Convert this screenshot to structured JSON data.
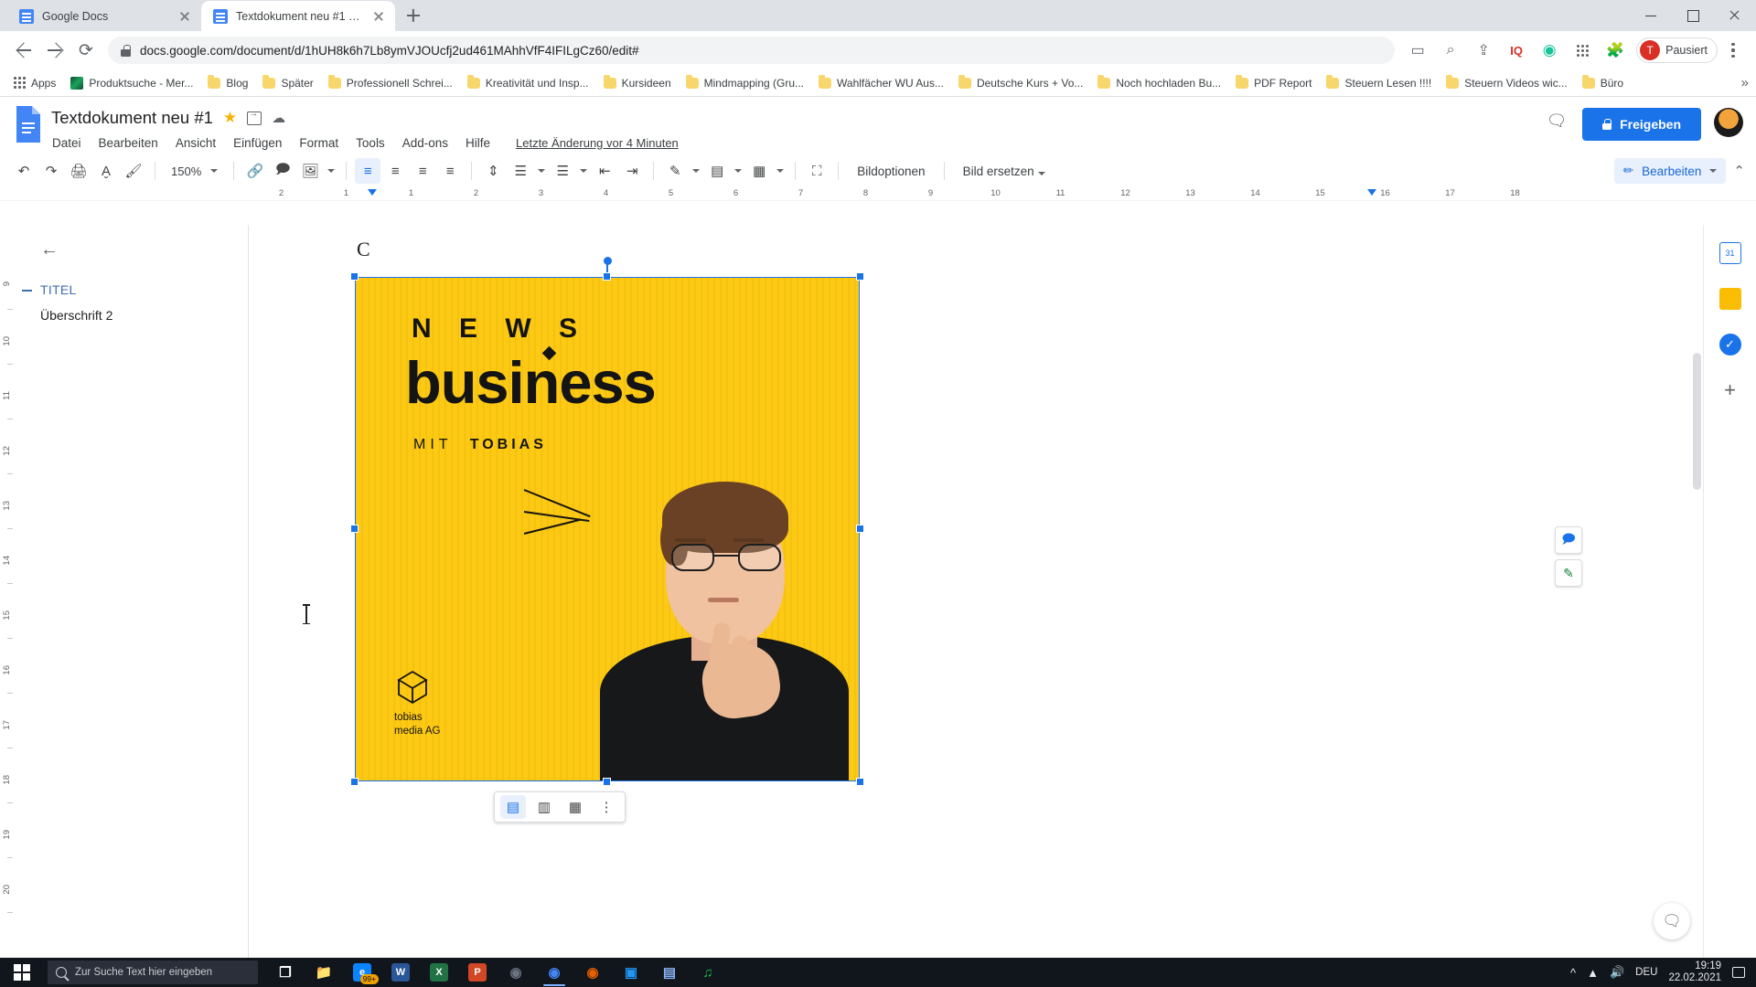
{
  "browser": {
    "tabs": [
      {
        "title": "Google Docs",
        "active": false
      },
      {
        "title": "Textdokument neu #1 - Google D",
        "active": true
      }
    ],
    "new_tab_label": "+",
    "url": "docs.google.com/document/d/1hUH8k6h7Lb8ymVJOUcfj2ud461MAhhVfF4IFILgCz60/edit#",
    "window_controls": {
      "minimize": "–",
      "maximize": "□",
      "close": "×"
    },
    "omnibox_icons": [
      "cast-icon",
      "zoom-icon",
      "share-icon",
      "iq-icon",
      "grammar-icon",
      "apps-icon",
      "extensions-icon"
    ],
    "profile": {
      "initial": "T",
      "label": "Pausiert"
    },
    "bookmarks": [
      {
        "label": "Apps",
        "icon": "apps-grid-icon"
      },
      {
        "label": "Produktsuche - Mer...",
        "icon": "site-favicon"
      },
      {
        "label": "Blog",
        "icon": "folder-icon"
      },
      {
        "label": "Später",
        "icon": "folder-icon"
      },
      {
        "label": "Professionell Schrei...",
        "icon": "folder-icon"
      },
      {
        "label": "Kreativität und Insp...",
        "icon": "folder-icon"
      },
      {
        "label": "Kursideen",
        "icon": "folder-icon"
      },
      {
        "label": "Mindmapping  (Gru...",
        "icon": "folder-icon"
      },
      {
        "label": "Wahlfächer WU Aus...",
        "icon": "folder-icon"
      },
      {
        "label": "Deutsche Kurs + Vo...",
        "icon": "folder-icon"
      },
      {
        "label": "Noch hochladen Bu...",
        "icon": "folder-icon"
      },
      {
        "label": "PDF Report",
        "icon": "folder-icon"
      },
      {
        "label": "Steuern Lesen !!!!",
        "icon": "folder-icon"
      },
      {
        "label": "Steuern Videos wic...",
        "icon": "folder-icon"
      },
      {
        "label": "Büro",
        "icon": "folder-icon"
      }
    ],
    "bookmarks_overflow": "»"
  },
  "docs": {
    "title": "Textdokument neu #1",
    "star_icon": "★",
    "menus": [
      "Datei",
      "Bearbeiten",
      "Ansicht",
      "Einfügen",
      "Format",
      "Tools",
      "Add-ons",
      "Hilfe"
    ],
    "last_edit": "Letzte Änderung vor 4 Minuten",
    "share_label": "Freigeben",
    "comment_icon": "comment-icon",
    "toolbar": {
      "zoom": "150%",
      "image_options": "Bildoptionen",
      "replace_image": "Bild ersetzen",
      "mode": "Bearbeiten"
    },
    "ruler": {
      "ticks": [
        "2",
        "1",
        "1",
        "2",
        "3",
        "4",
        "5",
        "6",
        "7",
        "8",
        "9",
        "10",
        "11",
        "12",
        "13",
        "14",
        "15",
        "16",
        "17",
        "18"
      ]
    },
    "vertical_ruler_ticks": [
      "9",
      "10",
      "11",
      "12",
      "13",
      "14",
      "15",
      "16",
      "17",
      "18",
      "19",
      "20"
    ],
    "outline": {
      "back_icon": "←",
      "items": [
        {
          "label": "TITEL",
          "level": "title"
        },
        {
          "label": "Überschrift 2",
          "level": "h2"
        }
      ]
    },
    "document": {
      "text_line": "C",
      "image": {
        "alt": "News business podcast cover",
        "bg_color": "#fdc913",
        "headline_small": "N E W S",
        "headline_large": "business",
        "subtitle_prefix": "MIT",
        "subtitle_name": "TOBIAS",
        "logo_line1": "tobias",
        "logo_line2": "media AG"
      }
    },
    "image_toolbar": {
      "buttons": [
        "wrap-inline-icon",
        "wrap-text-icon",
        "break-text-icon",
        "more-options-icon"
      ]
    },
    "side_actions": [
      "add-comment-icon",
      "suggest-edit-icon"
    ],
    "right_rail": [
      "google-keep-icon",
      "google-tasks-icon",
      "google-calendar-icon",
      "add-ons-plus-icon"
    ],
    "explore_icon": "explore-icon"
  },
  "taskbar": {
    "search_placeholder": "Zur Suche Text hier eingeben",
    "apps": [
      {
        "name": "task-view-icon",
        "glyph": "❐",
        "color": "#ffffff"
      },
      {
        "name": "file-explorer-icon",
        "glyph": "📁",
        "color": "#f6b93b"
      },
      {
        "name": "edge-icon",
        "glyph": "e",
        "color": "#0a84ff",
        "badge": "99+"
      },
      {
        "name": "word-icon",
        "glyph": "W",
        "color": "#2b579a"
      },
      {
        "name": "excel-icon",
        "glyph": "X",
        "color": "#217346"
      },
      {
        "name": "powerpoint-icon",
        "glyph": "P",
        "color": "#d24726"
      },
      {
        "name": "disc-icon",
        "glyph": "◉",
        "color": "#6b7280"
      },
      {
        "name": "chrome-icon",
        "glyph": "◉",
        "color": "#4285f4"
      },
      {
        "name": "firefox-icon",
        "glyph": "◉",
        "color": "#e66000"
      },
      {
        "name": "screen-recorder-icon",
        "glyph": "▣",
        "color": "#2196f3"
      },
      {
        "name": "photos-icon",
        "glyph": "▤",
        "color": "#8ab4f8"
      },
      {
        "name": "spotify-icon",
        "glyph": "♫",
        "color": "#1db954"
      }
    ],
    "tray": {
      "overflow": "^",
      "network_icon": "network-icon",
      "volume_icon": "volume-icon",
      "language": "DEU",
      "time": "19:19",
      "date": "22.02.2021",
      "notification_icon": "notification-icon"
    }
  }
}
